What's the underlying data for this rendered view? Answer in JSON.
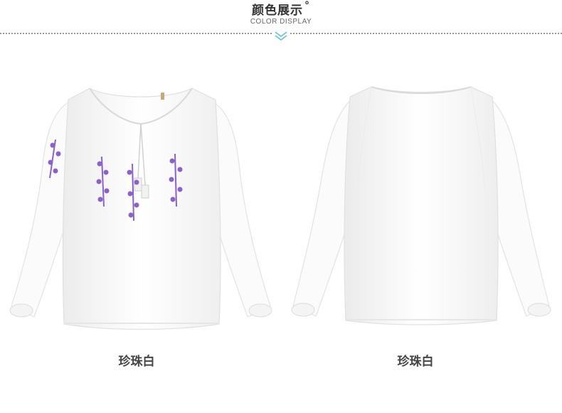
{
  "header": {
    "title": "颜色展示",
    "degree_mark": "°",
    "subtitle": "COLOR DISPLAY",
    "divider_icon": "double-chevron-down-icon",
    "accent_color": "#5fc5c8"
  },
  "products": [
    {
      "color_name": "珍珠白",
      "view": "front",
      "garment_color": "#ffffff",
      "embroidery_color": "#8a62c8"
    },
    {
      "color_name": "珍珠白",
      "view": "back",
      "garment_color": "#ffffff"
    }
  ]
}
